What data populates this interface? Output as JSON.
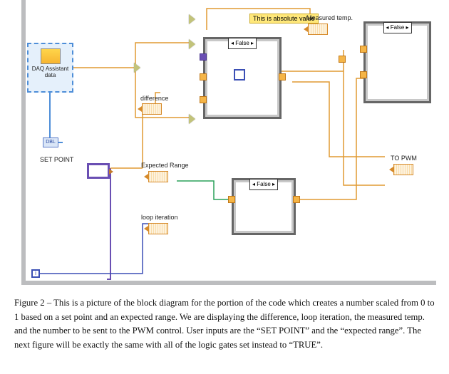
{
  "diagram": {
    "daq": {
      "line1": "DAQ Assistant",
      "line2": "data"
    },
    "tooltip": "This is absolute value",
    "labels": {
      "measured_temp": "Measured temp.",
      "difference": "difference",
      "set_point": "SET POINT",
      "expected_range": "Expected Range",
      "loop_iteration": "loop iteration",
      "to_pwm": "TO PWM"
    },
    "case1_sel": "◂ False ▸",
    "case2_sel": "◂ False ▸",
    "case3_sel": "◂ False ▸",
    "iter_glyph": "i",
    "conv_glyph": "DBL"
  },
  "caption": "Figure 2 – This is a picture of the block diagram for the portion of the code which creates a number scaled from 0 to 1 based on a set point and an expected range.  We are displaying the difference, loop iteration, the measured temp. and the number to be sent to the PWM control.  User inputs are the “SET POINT” and the “expected range”.  The next figure will be exactly the same with all of the logic gates set instead to “TRUE”."
}
